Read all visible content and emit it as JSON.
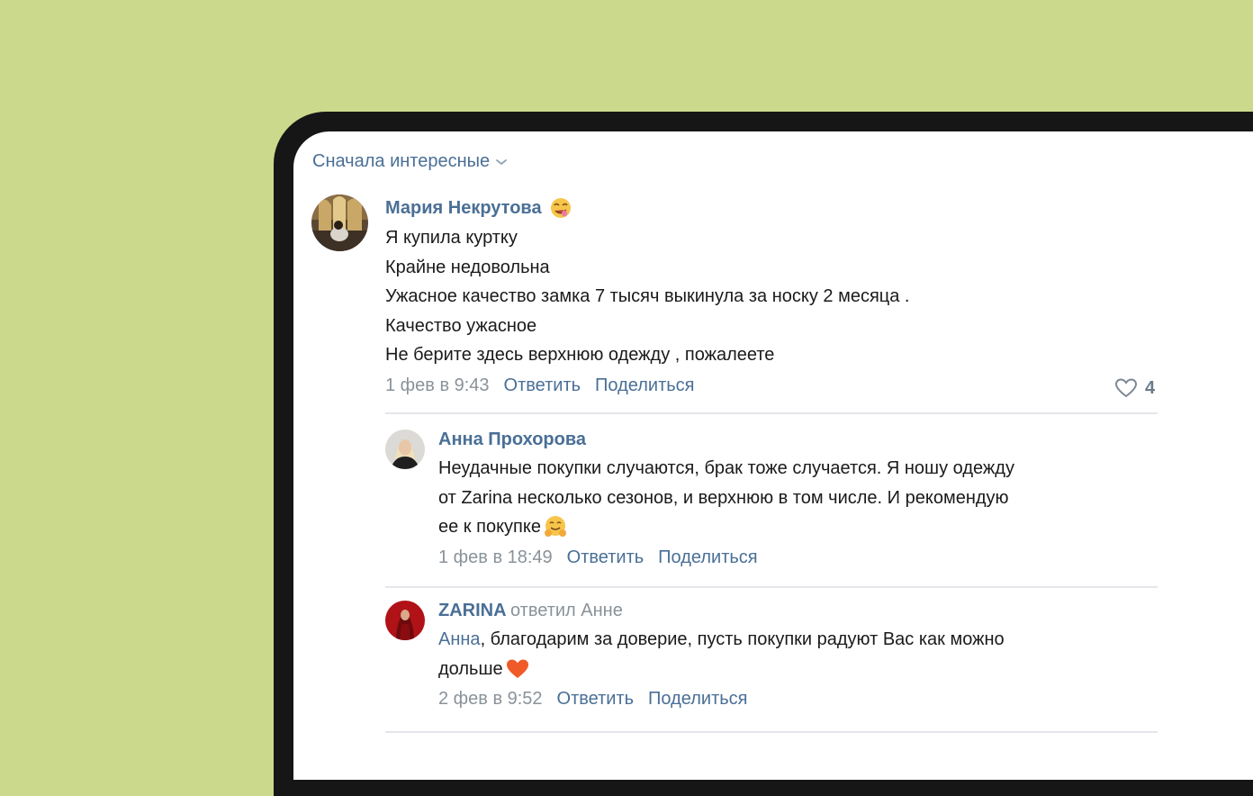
{
  "sort": {
    "label": "Сначала интересные"
  },
  "comments": [
    {
      "author": "Мария Некрутова",
      "lines": [
        "Я купила куртку",
        "Крайне недовольна",
        "Ужасное качество замка 7 тысяч выкинула за носку 2 месяца .",
        "Качество ужасное",
        "Не берите здесь верхнюю одежду , пожалеете"
      ],
      "date": "1 фев в 9:43",
      "reply_label": "Ответить",
      "share_label": "Поделиться",
      "likes": "4"
    },
    {
      "author": "Анна Прохорова",
      "lines": [
        "Неудачные покупки случаются, брак тоже случается. Я ношу одежду",
        "от Zarina несколько сезонов, и верхнюю в том числе. И рекомендую",
        "ее к покупке"
      ],
      "date": "1 фев в 18:49",
      "reply_label": "Ответить",
      "share_label": "Поделиться"
    },
    {
      "author": "ZARINA",
      "replied_to": "ответил Анне",
      "mention": "Анна",
      "lines": [
        ", благодарим за доверие, пусть покупки радуют Вас как можно",
        "дольше"
      ],
      "date": "2 фев в 9:52",
      "reply_label": "Ответить",
      "share_label": "Поделиться"
    }
  ],
  "colors": {
    "background": "#cbd98c",
    "frame": "#161616",
    "link": "#4a6f96",
    "meta": "#8a9299"
  }
}
